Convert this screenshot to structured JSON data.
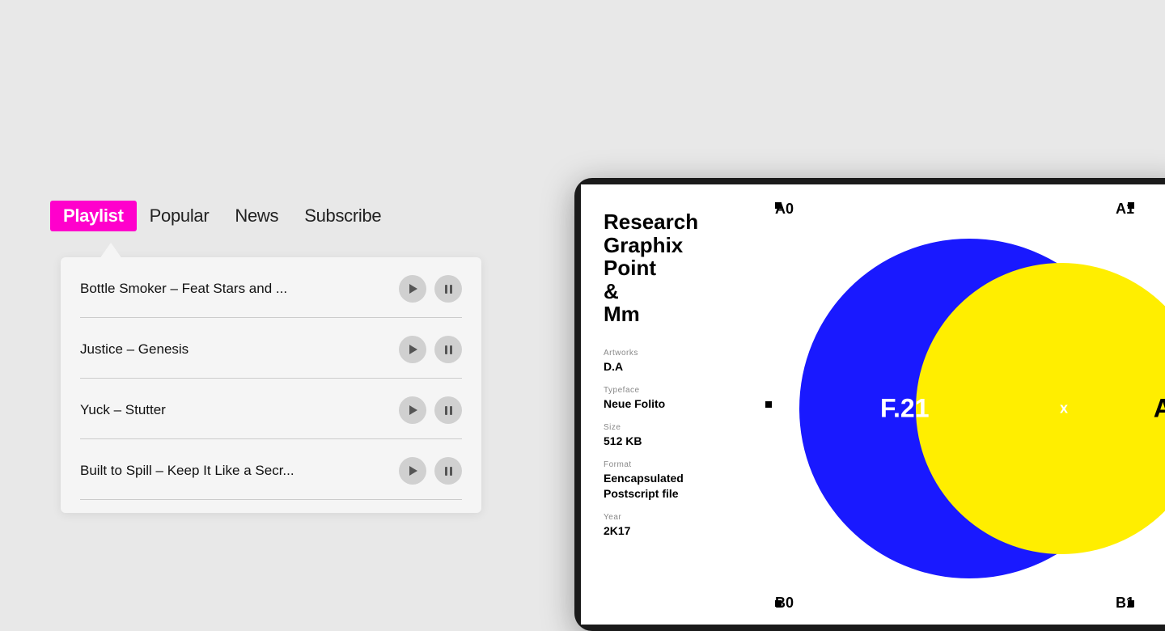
{
  "nav": {
    "tabs": [
      {
        "id": "playlist",
        "label": "Playlist",
        "active": true
      },
      {
        "id": "popular",
        "label": "Popular",
        "active": false
      },
      {
        "id": "news",
        "label": "News",
        "active": false
      },
      {
        "id": "subscribe",
        "label": "Subscribe",
        "active": false
      }
    ]
  },
  "playlist": {
    "tracks": [
      {
        "id": 1,
        "title": "Bottle Smoker –  Feat Stars and ..."
      },
      {
        "id": 2,
        "title": "Justice – Genesis"
      },
      {
        "id": 3,
        "title": "Yuck – Stutter"
      },
      {
        "id": 4,
        "title": "Built to Spill – Keep It Like a Secr..."
      }
    ]
  },
  "device": {
    "font_name": "Research\nGraphix\nPoint\n&\nMm",
    "font_name_lines": [
      "Research",
      "Graphix",
      "Point",
      "&",
      "Mm"
    ],
    "artworks_label": "Artworks",
    "artworks_value": "D.A",
    "typeface_label": "Typeface",
    "typeface_value": "Neue Folito",
    "size_label": "Size",
    "size_value": "512 KB",
    "format_label": "Format",
    "format_value": "Eencapsulated\nPostscript file",
    "year_label": "Year",
    "year_value": "2K17",
    "grid": {
      "a0": "A0",
      "a1": "A1",
      "b0": "B0",
      "b1": "B1"
    },
    "venn": {
      "center_label": "F.21",
      "overlap_label": "x",
      "right_label": "AB"
    }
  },
  "colors": {
    "accent": "#ff00cc",
    "blue": "#1919ff",
    "yellow": "#ffee00",
    "red": "#cc2200"
  }
}
